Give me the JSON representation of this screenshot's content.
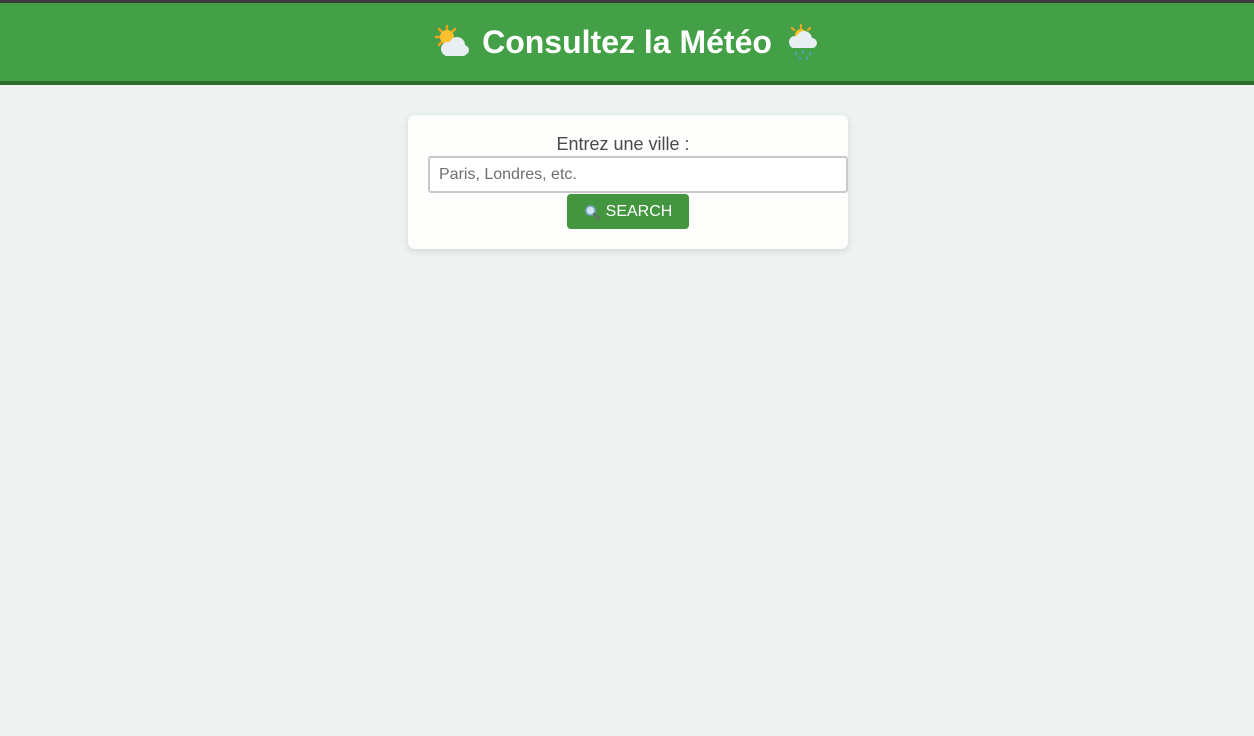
{
  "header": {
    "title": "Consultez la Météo",
    "left_icon": "sun-behind-cloud-icon",
    "right_icon": "sun-behind-rain-cloud-icon",
    "background_color": "#43a047"
  },
  "search_form": {
    "label": "Entrez une ville :",
    "input_value": "",
    "input_placeholder": "Paris, Londres, etc.",
    "button_label": "SEARCH",
    "button_icon": "magnifier-icon",
    "button_color": "#43953f"
  }
}
